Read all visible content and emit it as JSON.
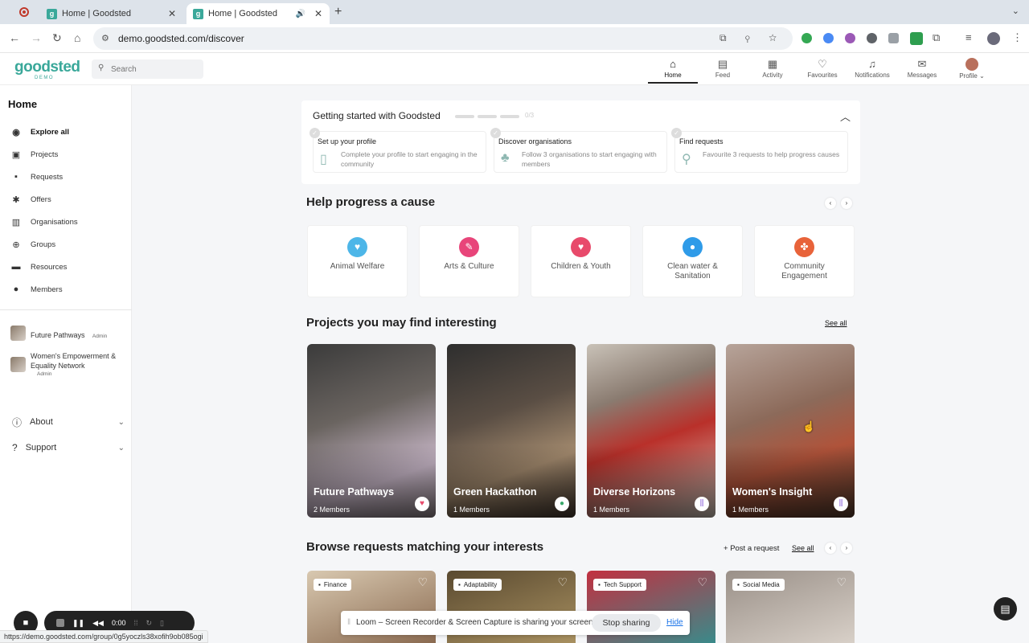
{
  "browser": {
    "tabs": [
      {
        "title": "Home | Goodsted"
      },
      {
        "title": "Home | Goodsted"
      }
    ],
    "url": "demo.goodsted.com/discover",
    "status_url": "https://demo.goodsted.com/group/0g5yoczls38xofih9ob085ogi"
  },
  "header": {
    "logo": "goodsted",
    "logo_sub": "DEMO",
    "search_placeholder": "Search",
    "nav": [
      {
        "label": "Home",
        "icon": "home-icon"
      },
      {
        "label": "Feed",
        "icon": "feed-icon"
      },
      {
        "label": "Activity",
        "icon": "activity-icon"
      },
      {
        "label": "Favourites",
        "icon": "heart-icon"
      },
      {
        "label": "Notifications",
        "icon": "bell-icon"
      },
      {
        "label": "Messages",
        "icon": "message-icon"
      },
      {
        "label": "Profile",
        "icon": "avatar"
      }
    ]
  },
  "sidebar": {
    "title": "Home",
    "items": [
      {
        "label": "Explore all",
        "icon": "compass-icon"
      },
      {
        "label": "Projects",
        "icon": "projects-icon"
      },
      {
        "label": "Requests",
        "icon": "requests-icon"
      },
      {
        "label": "Offers",
        "icon": "offers-icon"
      },
      {
        "label": "Organisations",
        "icon": "organisations-icon"
      },
      {
        "label": "Groups",
        "icon": "groups-icon"
      },
      {
        "label": "Resources",
        "icon": "folder-icon"
      },
      {
        "label": "Members",
        "icon": "members-icon"
      }
    ],
    "groups": [
      {
        "name": "Future Pathways",
        "role": "Admin"
      },
      {
        "name": "Women's Empowerment & Equality Network",
        "role": "Admin"
      }
    ],
    "about_label": "About",
    "support_label": "Support"
  },
  "getting_started": {
    "title": "Getting started with Goodsted",
    "count": "0/3",
    "steps": [
      {
        "title": "Set up your profile",
        "desc": "Complete your profile to start engaging in the community"
      },
      {
        "title": "Discover organisations",
        "desc": "Follow 3 organisations to start engaging with members"
      },
      {
        "title": "Find requests",
        "desc": "Favourite 3 requests to help progress causes"
      }
    ]
  },
  "causes": {
    "title": "Help progress a cause",
    "items": [
      {
        "label": "Animal Welfare",
        "color": "#4db6e8"
      },
      {
        "label": "Arts & Culture",
        "color": "#e8457a"
      },
      {
        "label": "Children & Youth",
        "color": "#e84a6b"
      },
      {
        "label": "Clean water & Sanitation",
        "color": "#2f9be8"
      },
      {
        "label": "Community Engagement",
        "color": "#e8633a"
      }
    ]
  },
  "projects": {
    "title": "Projects you may find interesting",
    "see_all": "See all",
    "items": [
      {
        "name": "Future Pathways",
        "members": "2 Members"
      },
      {
        "name": "Green Hackathon",
        "members": "1 Members"
      },
      {
        "name": "Diverse Horizons",
        "members": "1 Members"
      },
      {
        "name": "Women's Insight",
        "members": "1 Members"
      }
    ]
  },
  "requests": {
    "title": "Browse requests matching your interests",
    "post_label": "Post a request",
    "see_all": "See all",
    "items": [
      {
        "tag": "Finance"
      },
      {
        "tag": "Adaptability"
      },
      {
        "tag": "Tech Support"
      },
      {
        "tag": "Social Media"
      }
    ]
  },
  "recorder": {
    "time": "0:00",
    "share_message": "Loom – Screen Recorder & Screen Capture is sharing your screen.",
    "stop_label": "Stop sharing",
    "hide_label": "Hide"
  }
}
